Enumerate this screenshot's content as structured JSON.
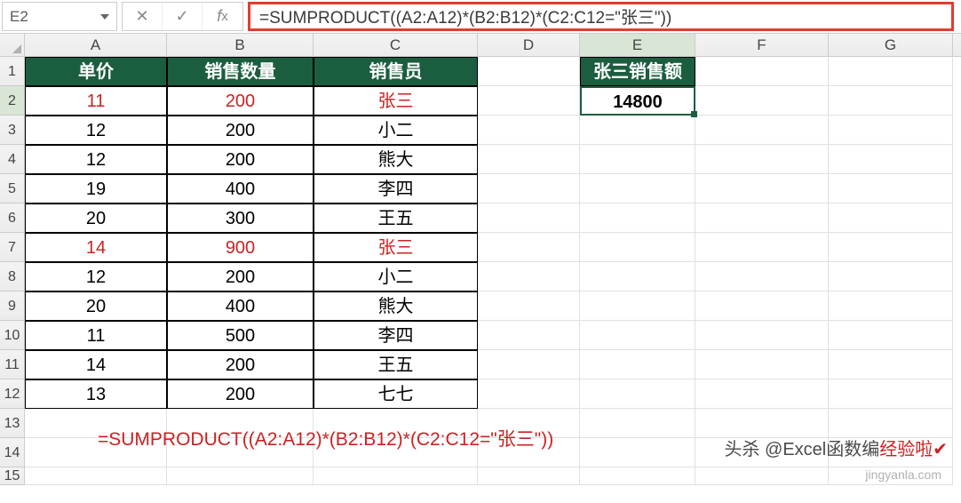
{
  "nameBox": "E2",
  "formula": "=SUMPRODUCT((A2:A12)*(B2:B12)*(C2:C12=\"张三\"))",
  "columns": [
    "A",
    "B",
    "C",
    "D",
    "E",
    "F",
    "G"
  ],
  "headers": {
    "A": "单价",
    "B": "销售数量",
    "C": "销售员",
    "E": "张三销售额"
  },
  "result": "14800",
  "tableRows": [
    {
      "price": "11",
      "qty": "200",
      "sales": "张三",
      "red": true
    },
    {
      "price": "12",
      "qty": "200",
      "sales": "小二",
      "red": false
    },
    {
      "price": "12",
      "qty": "200",
      "sales": "熊大",
      "red": false
    },
    {
      "price": "19",
      "qty": "400",
      "sales": "李四",
      "red": false
    },
    {
      "price": "20",
      "qty": "300",
      "sales": "王五",
      "red": false
    },
    {
      "price": "14",
      "qty": "900",
      "sales": "张三",
      "red": true
    },
    {
      "price": "12",
      "qty": "200",
      "sales": "小二",
      "red": false
    },
    {
      "price": "20",
      "qty": "400",
      "sales": "熊大",
      "red": false
    },
    {
      "price": "11",
      "qty": "500",
      "sales": "李四",
      "red": false
    },
    {
      "price": "14",
      "qty": "200",
      "sales": "王五",
      "red": false
    },
    {
      "price": "13",
      "qty": "200",
      "sales": "七七",
      "red": false
    }
  ],
  "annotation": "=SUMPRODUCT((A2:A12)*(B2:B12)*(C2:C12=\"张三\"))",
  "watermark1_prefix": "头杀 @Excel函数编",
  "watermark1_suffix": "经验啦✔",
  "watermark1_mid": "",
  "watermark2": "jingyanla.com"
}
